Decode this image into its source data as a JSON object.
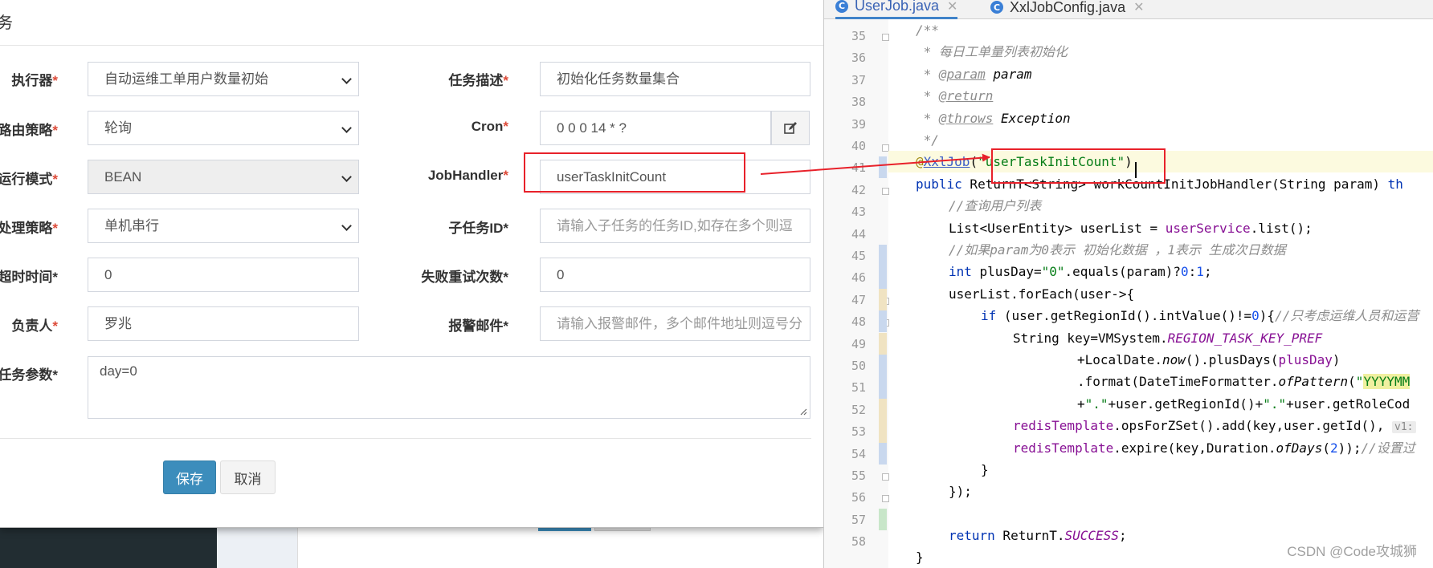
{
  "modal": {
    "title": "务",
    "fields": [
      {
        "label": "执行器",
        "required": true,
        "value": "自动运维工单用户数量初始",
        "type": "select"
      },
      {
        "label": "任务描述",
        "required": true,
        "value": "初始化任务数量集合",
        "type": "input"
      },
      {
        "label": "路由策略",
        "required": true,
        "value": "轮询",
        "type": "select"
      },
      {
        "label": "Cron",
        "required": true,
        "value": "0 0 0 14 * ?",
        "type": "input"
      },
      {
        "label": "运行模式",
        "required": true,
        "value": "BEAN",
        "type": "select"
      },
      {
        "label": "JobHandler",
        "required": true,
        "value": "userTaskInitCount",
        "type": "input"
      },
      {
        "label": "处理策略",
        "required": true,
        "value": "单机串行",
        "type": "select"
      },
      {
        "label": "子任务ID",
        "required": false,
        "placeholder": "请输入子任务的任务ID,如存在多个则逗",
        "type": "input"
      },
      {
        "label": "超时时间",
        "required": false,
        "value": "0",
        "type": "input"
      },
      {
        "label": "失败重试次数",
        "required": false,
        "value": "0",
        "type": "input"
      },
      {
        "label": "负责人",
        "required": true,
        "value": "罗兆",
        "type": "input"
      },
      {
        "label": "报警邮件",
        "required": false,
        "placeholder": "请输入报警邮件，多个邮件地址则逗号分",
        "type": "input"
      },
      {
        "label": "任务参数",
        "required": false,
        "value": "day=0",
        "type": "textarea"
      }
    ],
    "save_label": "保存",
    "cancel_label": "取消"
  },
  "ide": {
    "tabs": [
      {
        "name": "UserJob.java",
        "active": true
      },
      {
        "name": "XxlJobConfig.java",
        "active": false
      }
    ],
    "line_numbers": [
      "35",
      "36",
      "37",
      "38",
      "39",
      "40",
      "41",
      "42",
      "43",
      "44",
      "45",
      "46",
      "47",
      "48",
      "49",
      "50",
      "51",
      "52",
      "53",
      "54",
      "55",
      "56",
      "57",
      "58"
    ],
    "code": {
      "l35": "/**",
      "l36": " * 每日工单量列表初始化",
      "l37_star": " * ",
      "l37_tag": "@param",
      "l37_rest": " param",
      "l38_star": " * ",
      "l38_tag": "@return",
      "l39_star": " * ",
      "l39_tag": "@throws",
      "l39_rest": " Exception",
      "l40": " */",
      "l41_at": "@",
      "l41_anno": "XxlJob",
      "l41_open": "(",
      "l41_str": "\"userTaskInitCount\"",
      "l41_close": ")",
      "l42_kw": "public",
      "l42_rest": " ReturnT<String> workCountInitJobHandler(String param) ",
      "l42_tail": "th",
      "l43": "//查询用户列表",
      "l44_a": "List<UserEntity> userList = ",
      "l44_field": "userService",
      "l44_b": ".list();",
      "l45": "//如果param为0表示 初始化数据 ，1表示 生成次日数据",
      "l46_kw": "int",
      "l46_a": " plusDay=",
      "l46_str": "\"0\"",
      "l46_b": ".equals(param)?",
      "l46_n0": "0",
      "l46_c": ":",
      "l46_n1": "1",
      "l46_d": ";",
      "l47": "userList.forEach(user->{",
      "l48_kw": "if",
      "l48_a": " (user.getRegionId().intValue()!=",
      "l48_n": "0",
      "l48_b": "){",
      "l48_cm": "//只考虑运维人员和运营",
      "l49_a": "String key=VMSystem.",
      "l49_sf": "REGION_TASK_KEY_PREF",
      "l50_a": "+LocalDate.",
      "l50_sm": "now",
      "l50_b": "().plusDays(",
      "l50_v": "plusDay",
      "l50_c": ")",
      "l51_a": ".format(DateTimeFormatter.",
      "l51_sm": "ofPattern",
      "l51_b": "(",
      "l51_str": "\"",
      "l51_strhl": "YYYYMM",
      "l52_a": "+",
      "l52_s1": "\".\"",
      "l52_b": "+user.getRegionId()+",
      "l52_s2": "\".\"",
      "l52_c": "+user.getRoleCod",
      "l53_f": "redisTemplate",
      "l53_a": ".opsForZSet().add(key,user.getId(), ",
      "l53_hint": "v1:",
      "l54_f": "redisTemplate",
      "l54_a": ".expire(key,Duration.",
      "l54_sm": "ofDays",
      "l54_b": "(",
      "l54_n": "2",
      "l54_c": "));",
      "l54_cm": "//设置过",
      "l55": "}",
      "l56": "});",
      "l58_kw": "return",
      "l58_a": " ReturnT.",
      "l58_sf": "SUCCESS",
      "l58_b": ";",
      "l59": "}"
    }
  },
  "watermark": "CSDN @Code攻城狮",
  "colors": {
    "highlight_red": "#e8212a",
    "primary_blue": "#3c8dbc",
    "required_red": "#dd4b39"
  }
}
